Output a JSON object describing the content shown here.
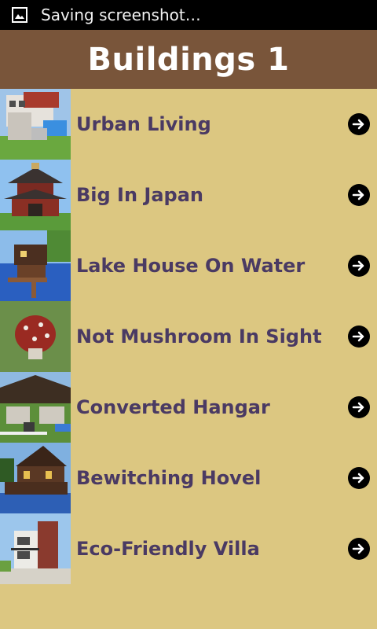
{
  "status_bar": {
    "text": "Saving screenshot…"
  },
  "header": {
    "title": "Buildings 1"
  },
  "items": [
    {
      "label": "Urban Living"
    },
    {
      "label": "Big In Japan"
    },
    {
      "label": "Lake House On Water"
    },
    {
      "label": "Not Mushroom In Sight"
    },
    {
      "label": "Converted Hangar"
    },
    {
      "label": "Bewitching Hovel"
    },
    {
      "label": "Eco-Friendly Villa"
    }
  ],
  "icons": {
    "status": "image-icon",
    "row_action": "arrow-right-circle-icon"
  },
  "colors": {
    "background": "#dcc781",
    "header": "#79553a",
    "label": "#4a3a63",
    "status_bar": "#000000"
  }
}
